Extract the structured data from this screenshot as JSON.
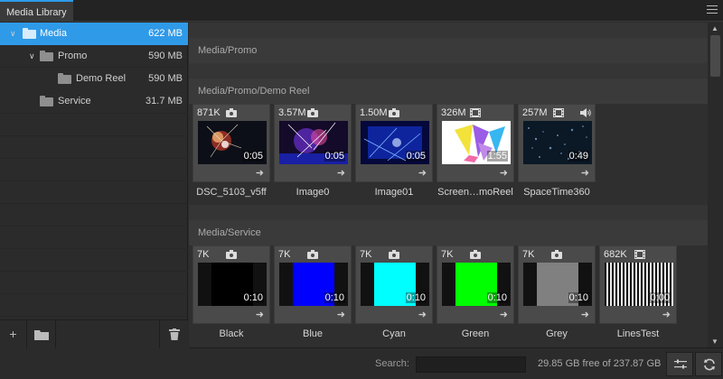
{
  "window": {
    "tab_title": "Media Library"
  },
  "sidebar": {
    "items": [
      {
        "label": "Media",
        "size": "622 MB",
        "expanded": true,
        "selected": true
      },
      {
        "label": "Promo",
        "size": "590 MB",
        "expanded": true,
        "selected": false
      },
      {
        "label": "Demo Reel",
        "size": "590 MB",
        "expanded": false,
        "selected": false
      },
      {
        "label": "Service",
        "size": "31.7 MB",
        "expanded": false,
        "selected": false
      }
    ],
    "footer": {
      "add": "+",
      "new_folder_icon": "folder-icon",
      "delete_icon": "trash-icon"
    }
  },
  "sections": [
    {
      "title": "Media/Promo",
      "items": []
    },
    {
      "title": "Media/Promo/Demo Reel",
      "items": [
        {
          "name": "DSC_5103_v5ff",
          "size": "871K",
          "icon": "camera-icon",
          "duration": "0:05",
          "thumb": "fireworks"
        },
        {
          "name": "Image0",
          "size": "3.57M",
          "icon": "camera-icon",
          "duration": "0:05",
          "thumb": "concert"
        },
        {
          "name": "Image01",
          "size": "1.50M",
          "icon": "camera-icon",
          "duration": "0:05",
          "thumb": "bluelights"
        },
        {
          "name": "Screen…moReel",
          "size": "326M",
          "icon": "film-icon",
          "duration": "1:55",
          "thumb": "shapes"
        },
        {
          "name": "SpaceTime360",
          "size": "257M",
          "icon": "film-icon",
          "duration": "0:49",
          "thumb": "particles",
          "audio": true
        }
      ]
    },
    {
      "title": "Media/Service",
      "items": [
        {
          "name": "Black",
          "size": "7K",
          "icon": "camera-icon",
          "duration": "0:10",
          "swatch": "#000000"
        },
        {
          "name": "Blue",
          "size": "7K",
          "icon": "camera-icon",
          "duration": "0:10",
          "swatch": "#0000ff"
        },
        {
          "name": "Cyan",
          "size": "7K",
          "icon": "camera-icon",
          "duration": "0:10",
          "swatch": "#00ffff"
        },
        {
          "name": "Green",
          "size": "7K",
          "icon": "camera-icon",
          "duration": "0:10",
          "swatch": "#00ff00"
        },
        {
          "name": "Grey",
          "size": "7K",
          "icon": "camera-icon",
          "duration": "0:10",
          "swatch": "#808080"
        },
        {
          "name": "LinesTest",
          "size": "682K",
          "icon": "film-icon",
          "duration": "0:00",
          "thumb": "lines"
        }
      ]
    }
  ],
  "statusbar": {
    "search_label": "Search:",
    "search_value": "",
    "free_space": "29.85 GB free of 237.87 GB"
  },
  "colors": {
    "accent": "#2f9ae8",
    "panel": "#2f2f2f",
    "card": "#4a4a4a"
  }
}
